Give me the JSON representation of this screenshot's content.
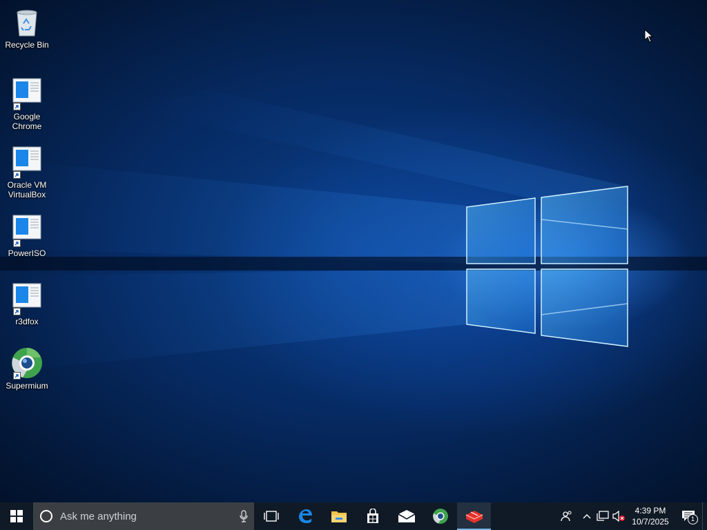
{
  "desktop": {
    "icons": [
      {
        "label": "Recycle Bin",
        "icon": "recycle-bin-icon"
      },
      {
        "label": "Google Chrome",
        "icon": "generic-app-icon"
      },
      {
        "label": "Oracle VM VirtualBox",
        "icon": "generic-app-icon"
      },
      {
        "label": "PowerISO",
        "icon": "generic-app-icon"
      },
      {
        "label": "r3dfox",
        "icon": "generic-app-icon"
      },
      {
        "label": "Supermium",
        "icon": "supermium-icon"
      }
    ]
  },
  "taskbar": {
    "search_placeholder": "Ask me anything",
    "pinned": [
      "task-view-icon",
      "edge-icon",
      "file-explorer-icon",
      "store-icon",
      "mail-icon",
      "supermium-icon",
      "app-icon"
    ],
    "clock": {
      "time": "4:39 PM",
      "date": "10/7/2025"
    },
    "notification_count": "1"
  },
  "colors": {
    "taskbar": "#101a26",
    "search_box": "#3b3f44",
    "accent": "#76b9ed"
  }
}
